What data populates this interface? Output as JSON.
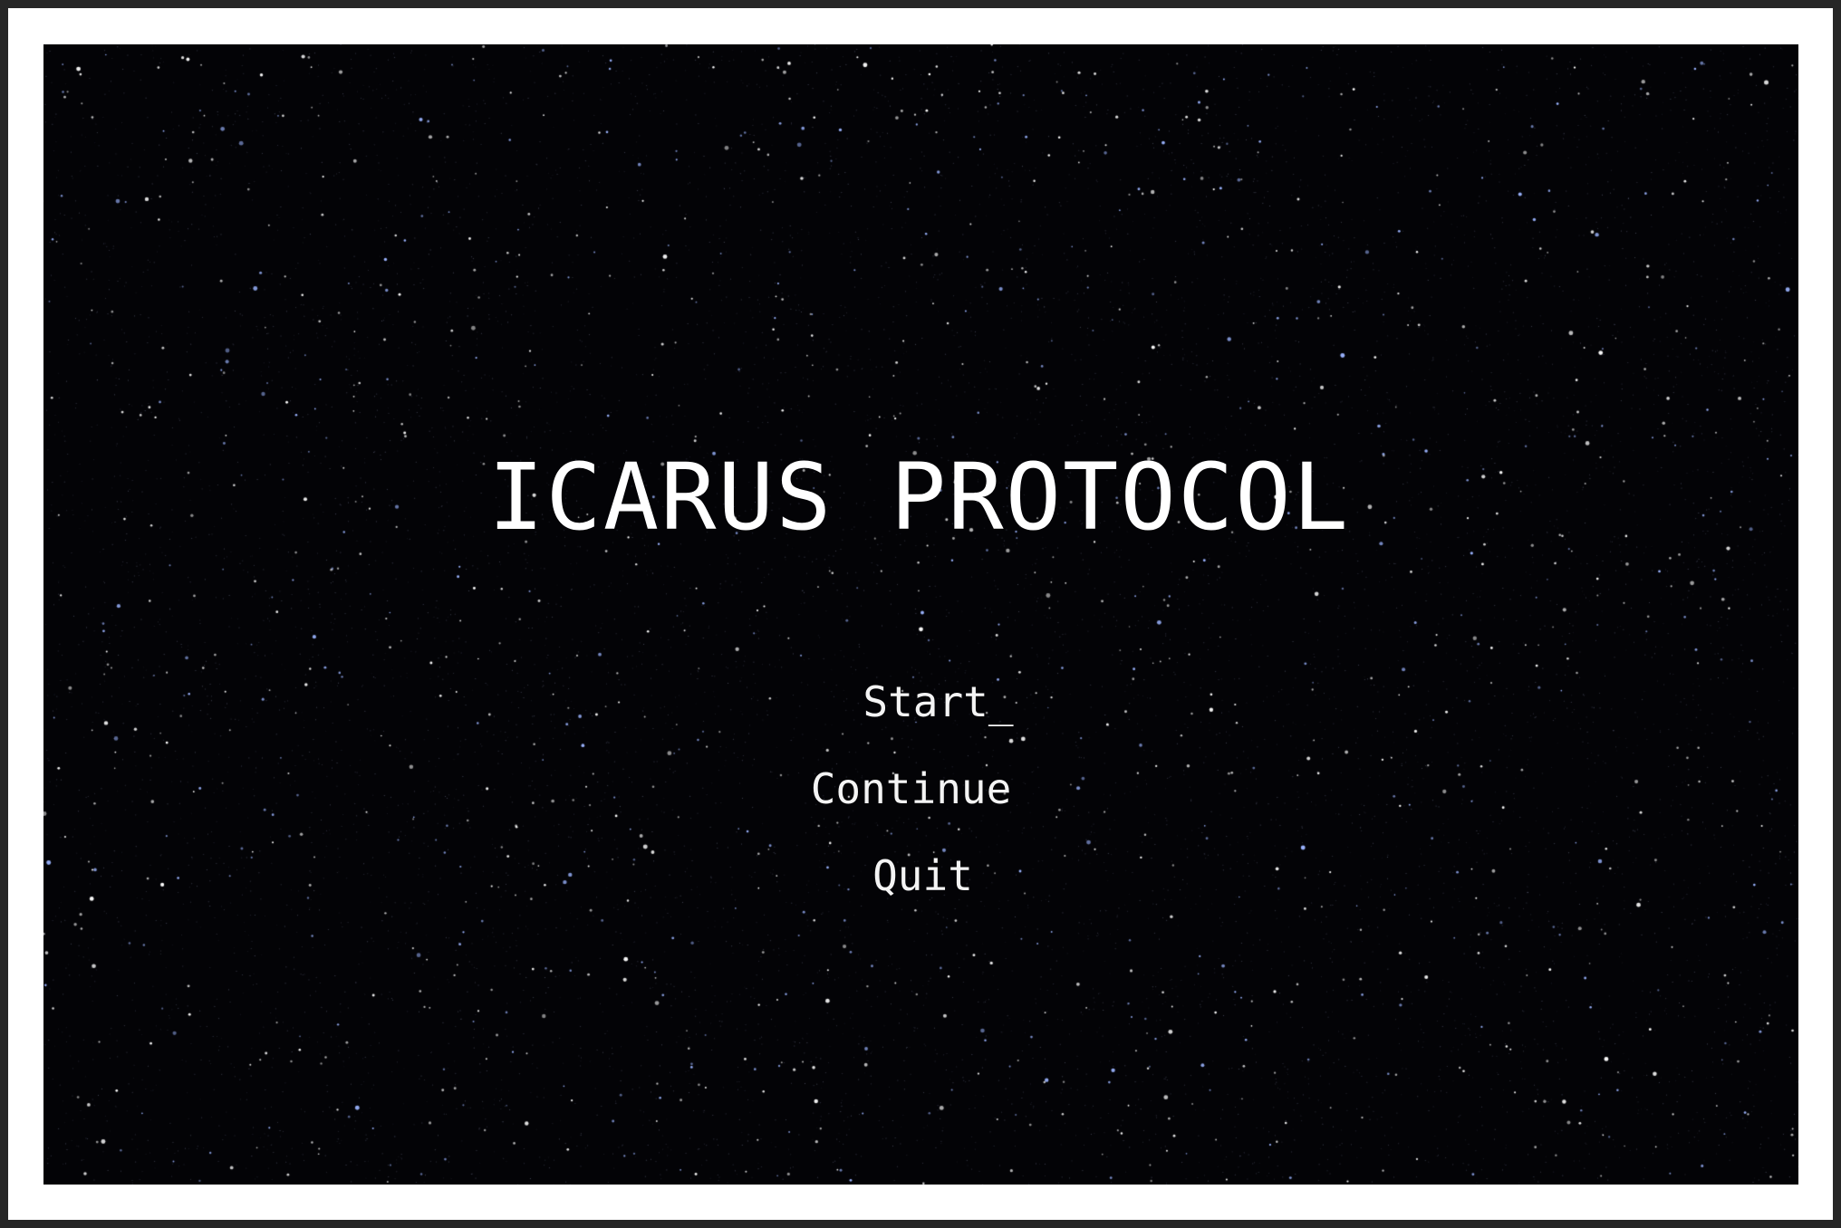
{
  "game": {
    "title": "ICARUS PROTOCOL",
    "menu": [
      {
        "label": "Start_",
        "selected": true
      },
      {
        "label": "Continue",
        "selected": false
      },
      {
        "label": "Quit",
        "selected": false
      }
    ]
  },
  "colors": {
    "bezel": "#262626",
    "frame": "#ffffff",
    "space": "#030306",
    "text": "#ffffff",
    "star_white": "#ffffff",
    "star_blue": "#9bb4ff"
  }
}
